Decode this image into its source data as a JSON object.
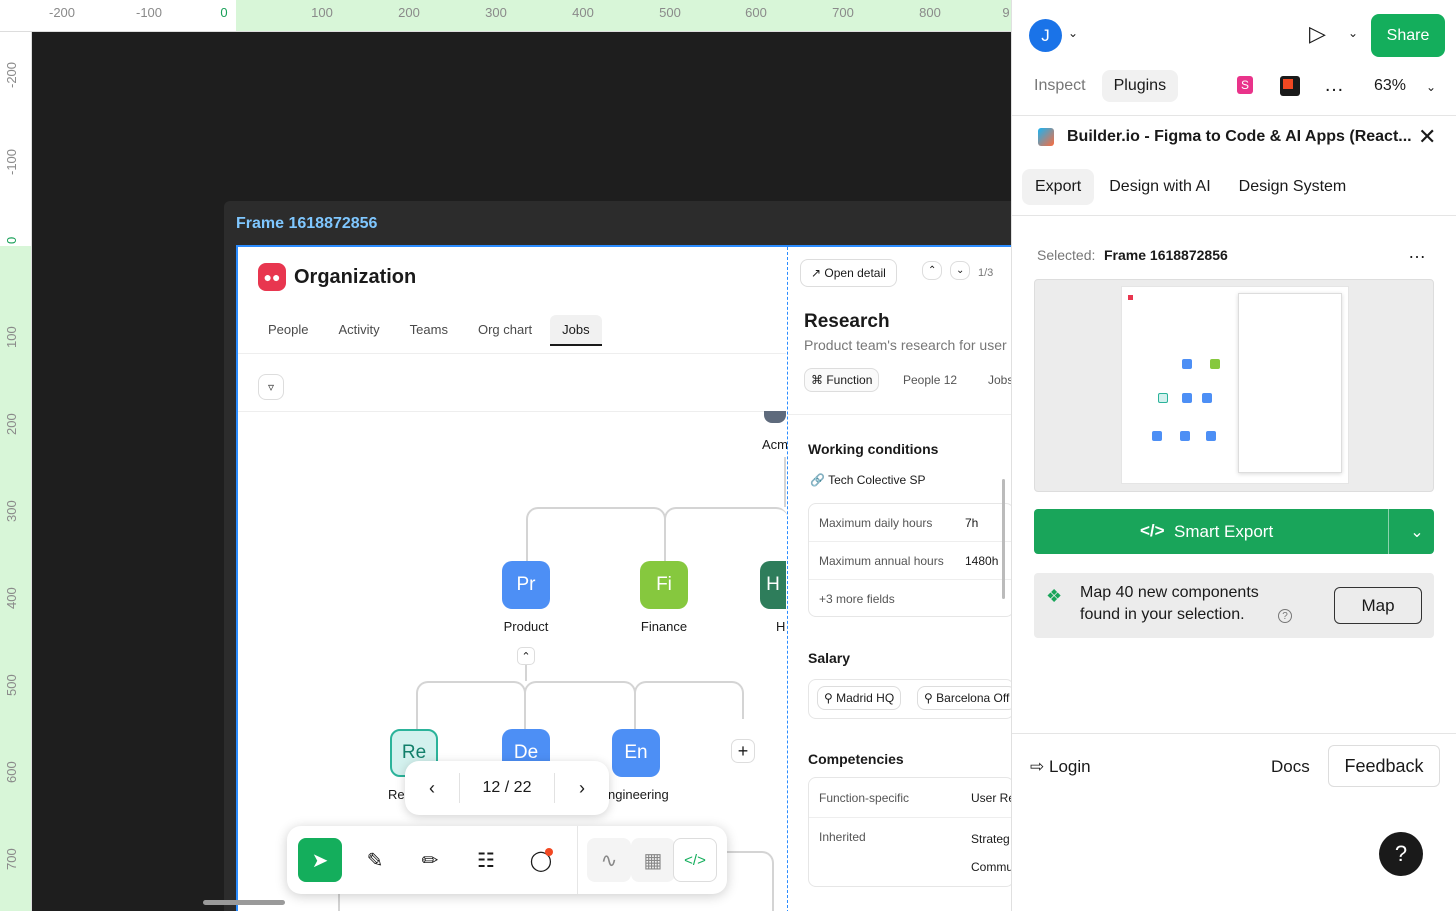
{
  "ruler": {
    "top_ticks": [
      "-200",
      "-100",
      "0",
      "100",
      "200",
      "300",
      "400",
      "500",
      "600",
      "700",
      "800",
      "9"
    ],
    "left_ticks": [
      "-200",
      "-100",
      "0",
      "100",
      "200",
      "300",
      "400",
      "500",
      "600",
      "700"
    ]
  },
  "canvas": {
    "frame_label": "Frame 1618872856"
  },
  "org": {
    "title": "Organization",
    "tabs": [
      "People",
      "Activity",
      "Teams",
      "Org chart",
      "Jobs"
    ],
    "active_tab": "Jobs",
    "top_node_label": "Acm",
    "nodes_l1": [
      {
        "abbr": "Pr",
        "label": "Product",
        "color": "#4d8ff5"
      },
      {
        "abbr": "Fi",
        "label": "Finance",
        "color": "#86c83e"
      },
      {
        "abbr": "H",
        "label": "H",
        "color": "#2e7d5b"
      }
    ],
    "nodes_l2": [
      {
        "abbr": "Re",
        "label": "Res",
        "color": "#d3f1ee"
      },
      {
        "abbr": "De",
        "label": "",
        "color": "#4d8ff5"
      },
      {
        "abbr": "En",
        "label": "ngineering",
        "color": "#4d8ff5"
      }
    ],
    "add_icon": "+"
  },
  "detail": {
    "open_detail": "Open detail",
    "counter": "1/3",
    "title": "Research",
    "description": "Product team's research for user",
    "chips": [
      "Function",
      "People 12",
      "Jobs"
    ],
    "working_conditions": {
      "title": "Working conditions",
      "link": "Tech Colective SP",
      "rows": [
        {
          "k": "Maximum daily hours",
          "v": "7h"
        },
        {
          "k": "Maximum annual hours",
          "v": "1480h"
        }
      ],
      "more": "+3 more fields"
    },
    "salary": {
      "title": "Salary",
      "locations": [
        "Madrid HQ",
        "Barcelona Off"
      ]
    },
    "competencies": {
      "title": "Competencies",
      "rows": [
        {
          "k": "Function-specific",
          "v": "User Re"
        },
        {
          "k": "Inherited",
          "v": "Strateg"
        }
      ],
      "extra": "Commu"
    }
  },
  "pager": {
    "text": "12 / 22"
  },
  "right_panel": {
    "avatar": "J",
    "share": "Share",
    "tabs": [
      "Inspect",
      "Plugins"
    ],
    "active_tab": "Plugins",
    "zoom": "63%",
    "plugin_title": "Builder.io - Figma to Code & AI Apps (React...",
    "plugin_tabs": [
      "Export",
      "Design with AI",
      "Design System"
    ],
    "active_plugin_tab": "Export",
    "selected_label": "Selected:",
    "selected_value": "Frame 1618872856",
    "smart_export": "Smart Export",
    "map_text_1": "Map 40 new components",
    "map_text_2": "found in your selection.",
    "map_button": "Map",
    "login": "Login",
    "docs": "Docs",
    "feedback": "Feedback",
    "help": "?"
  }
}
